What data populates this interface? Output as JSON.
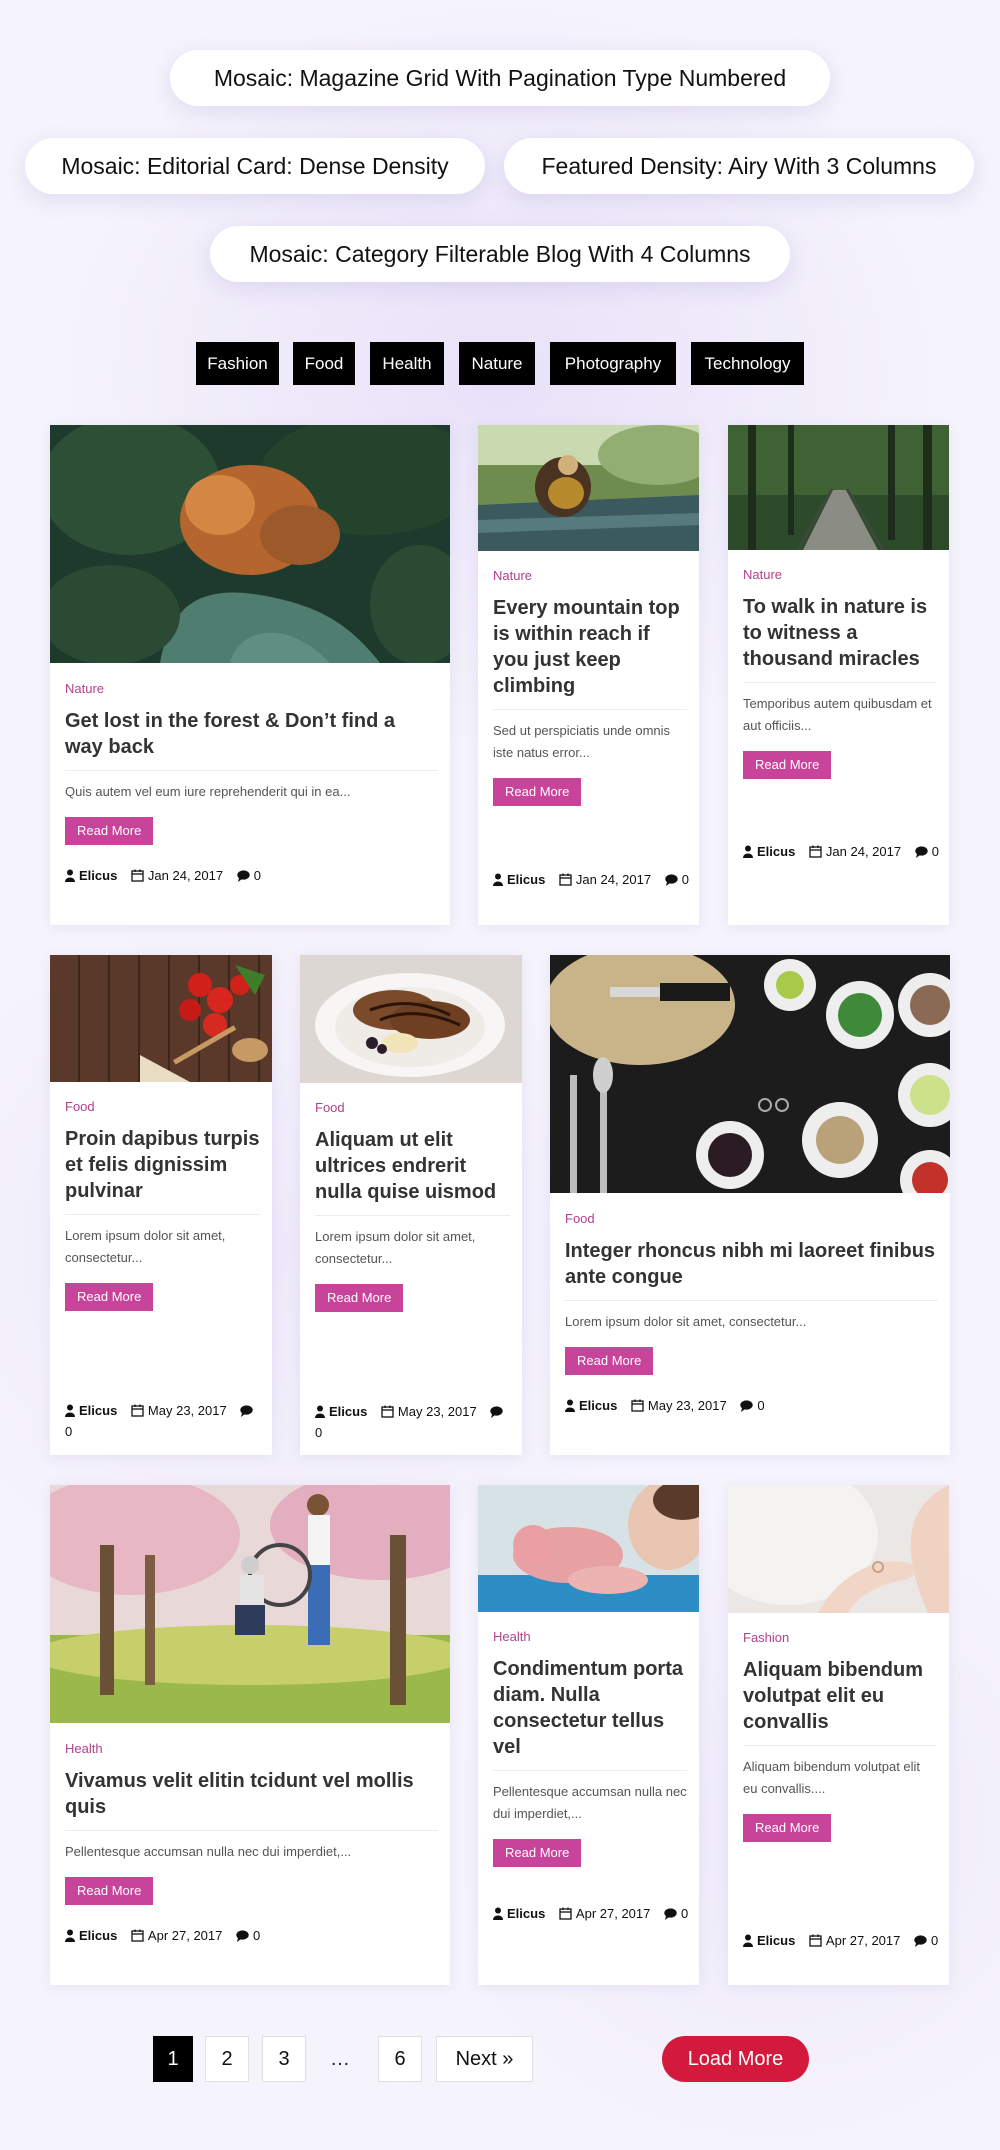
{
  "heading_pills": [
    "Mosaic: Magazine Grid With Pagination Type Numbered",
    "Mosaic: Editorial Card: Dense Density",
    "Featured Density: Airy With 3 Columns",
    "Mosaic: Category Filterable Blog With 4 Columns"
  ],
  "category_filters": [
    "Fashion",
    "Food",
    "Health",
    "Nature",
    "Photography",
    "Technology"
  ],
  "read_more_label": "Read More",
  "posts": [
    {
      "category": "Nature",
      "title": "Get lost in the forest & Don’t find a way back",
      "excerpt": "Quis autem vel eum iure reprehenderit qui in ea...",
      "author": "Elicus",
      "date": "Jan 24, 2017",
      "comments": "0",
      "image": "forest-aerial"
    },
    {
      "category": "Nature",
      "title": "Every mountain top is within reach if you just keep climbing",
      "excerpt": "Sed ut perspiciatis unde omnis iste natus error...",
      "author": "Elicus",
      "date": "Jan 24, 2017",
      "comments": "0",
      "image": "riverside-sitting"
    },
    {
      "category": "Nature",
      "title": "To walk in nature is to witness a thousand miracles",
      "excerpt": "Temporibus autem quibusdam et aut officiis...",
      "author": "Elicus",
      "date": "Jan 24, 2017",
      "comments": "0",
      "image": "forest-bridge"
    },
    {
      "category": "Food",
      "title": "Proin dapibus turpis et felis dignissim pulvinar",
      "excerpt": "Lorem ipsum dolor sit amet, consectetur...",
      "author": "Elicus",
      "date": "May 23, 2017",
      "comments": "0",
      "image": "tomatoes-wood"
    },
    {
      "category": "Food",
      "title": "Aliquam ut elit ultrices endrerit nulla quise uismod",
      "excerpt": "Lorem ipsum dolor sit amet, consectetur...",
      "author": "Elicus",
      "date": "May 23, 2017",
      "comments": "0",
      "image": "pancakes-plate"
    },
    {
      "category": "Food",
      "title": "Integer rhoncus nibh mi laoreet finibus ante congue",
      "excerpt": "Lorem ipsum dolor sit amet, consectetur...",
      "author": "Elicus",
      "date": "May 23, 2017",
      "comments": "0",
      "image": "bowls-cutlery"
    },
    {
      "category": "Health",
      "title": "Vivamus velit elitin tcidunt vel mollis quis",
      "excerpt": "Pellentesque accumsan nulla nec dui imperdiet,...",
      "author": "Elicus",
      "date": "Apr 27, 2017",
      "comments": "0",
      "image": "wheelchair-park"
    },
    {
      "category": "Health",
      "title": "Condimentum porta diam. Nulla consectetur tellus vel",
      "excerpt": "Pellentesque accumsan nulla nec dui imperdiet,...",
      "author": "Elicus",
      "date": "Apr 27, 2017",
      "comments": "0",
      "image": "newborn-baby"
    },
    {
      "category": "Fashion",
      "title": "Aliquam bibendum volutpat elit eu convallis",
      "excerpt": "Aliquam bibendum volutpat elit eu convallis....",
      "author": "Elicus",
      "date": "Apr 27, 2017",
      "comments": "0",
      "image": "hand-ring"
    }
  ],
  "pagination": {
    "pages": [
      "1",
      "2",
      "3",
      "6"
    ],
    "current": "1",
    "ellipsis": "…",
    "next_label": "Next »"
  },
  "load_more_label": "Load More",
  "colors": {
    "accent": "#c8449a",
    "category_text": "#b0428c",
    "load_more": "#d41a3c",
    "filter_bg": "#000000"
  }
}
